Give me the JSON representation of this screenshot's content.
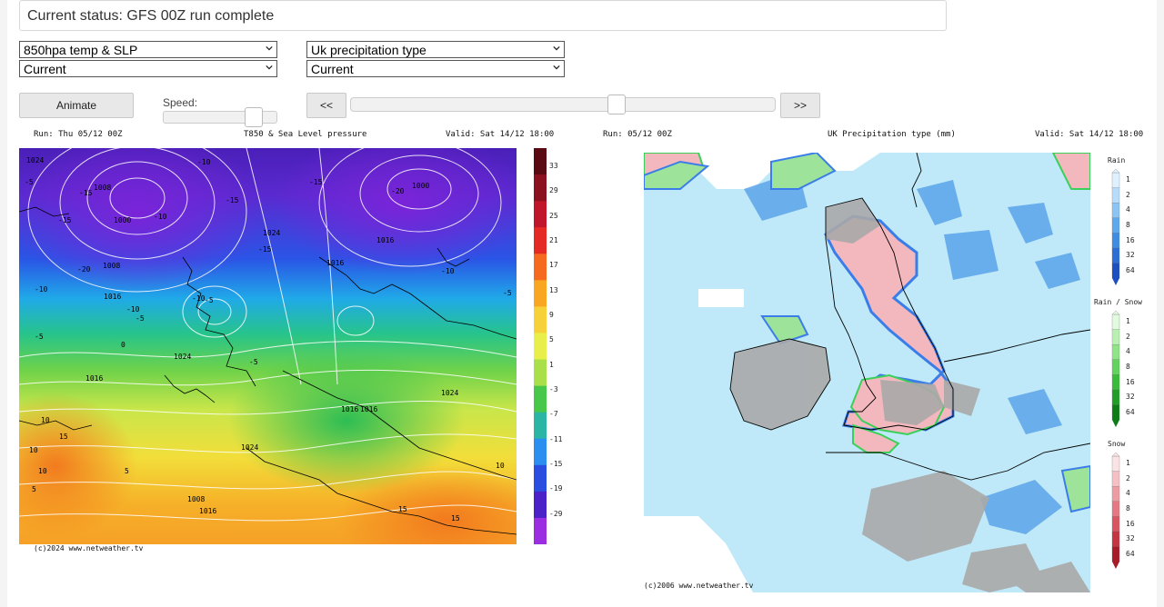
{
  "status": {
    "text": "Current status: GFS 00Z run complete"
  },
  "left_controls": {
    "chart_select": "850hpa temp & SLP",
    "time_select": "Current"
  },
  "right_controls": {
    "chart_select": "Uk precipitation type",
    "time_select": "Current"
  },
  "animation": {
    "animate_label": "Animate",
    "speed_label": "Speed:",
    "speed_value": 0.8,
    "prev_label": "<<",
    "next_label": ">>",
    "frame_position": 0.62
  },
  "left_map": {
    "run": "Run: Thu 05/12 00Z",
    "title": "T850 & Sea Level pressure",
    "valid": "Valid: Sat 14/12 18:00",
    "credit": "(c)2024 www.netweather.tv",
    "scale_labels": [
      "33",
      "29",
      "25",
      "21",
      "17",
      "13",
      "9",
      "5",
      "1",
      "-3",
      "-7",
      "-11",
      "-15",
      "-19",
      "-29"
    ],
    "scale_colors": [
      "#5a0a12",
      "#8b1020",
      "#c0152a",
      "#e52a25",
      "#f56a1f",
      "#f9a623",
      "#f7d13a",
      "#e8ef4a",
      "#a9e04a",
      "#48c84a",
      "#2ab5a5",
      "#2a8ff0",
      "#2a4fe0",
      "#4a22c8",
      "#9b2ee0"
    ],
    "pressure_labels": [
      "1024",
      "1008",
      "1000",
      "1000",
      "1024",
      "1016",
      "1016",
      "1008",
      "1016",
      "1024",
      "1016",
      "1016",
      "1024",
      "1016",
      "1008",
      "1024",
      "1016"
    ],
    "temp_labels": [
      "-10",
      "-15",
      "-15",
      "-15",
      "-20",
      "-20",
      "-15",
      "-10",
      "-10",
      "-5",
      "-5",
      "-10",
      "-15",
      "-10",
      "-5",
      "-5",
      "-10",
      "-5",
      "0",
      "-5",
      "10",
      "10",
      "10",
      "15",
      "15",
      "5",
      "10",
      "15",
      "5"
    ]
  },
  "right_map": {
    "run": "Run: 05/12 00Z",
    "title": "UK Precipitation type (mm)",
    "valid": "Valid: Sat 14/12 18:00",
    "credit": "(c)2006 www.netweather.tv",
    "legend": [
      {
        "title": "Rain",
        "labels": [
          "1",
          "2",
          "4",
          "8",
          "16",
          "32",
          "64"
        ],
        "colors": [
          "#dff0ff",
          "#b7dcfb",
          "#8cc4f6",
          "#5ea8ee",
          "#3f8de3",
          "#2b6fd6",
          "#1c4fc0"
        ]
      },
      {
        "title": "Rain / Snow",
        "labels": [
          "1",
          "2",
          "4",
          "8",
          "16",
          "32",
          "64"
        ],
        "colors": [
          "#e2fadf",
          "#b9f0b2",
          "#8fe487",
          "#62d35c",
          "#39bc3a",
          "#219e27",
          "#0e7d18"
        ]
      },
      {
        "title": "Snow",
        "labels": [
          "1",
          "2",
          "4",
          "8",
          "16",
          "32",
          "64"
        ],
        "colors": [
          "#fbe3e5",
          "#f5c0c5",
          "#ee9ca3",
          "#e57882",
          "#d95562",
          "#c53542",
          "#a81c2a"
        ]
      }
    ]
  }
}
